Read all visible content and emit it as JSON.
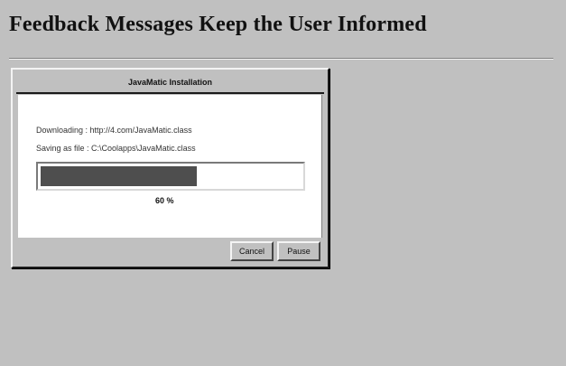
{
  "page": {
    "title": "Feedback Messages Keep the User Informed"
  },
  "dialog": {
    "title": "JavaMatic Installation",
    "downloading_text": "Downloading : http://4.com/JavaMatic.class",
    "saving_text": "Saving as file : C:\\Coolapps\\JavaMatic.class",
    "progress": {
      "fraction": 0.6,
      "label": "60 %"
    },
    "buttons": {
      "cancel_label": "Cancel",
      "pause_label": "Pause"
    }
  },
  "colors": {
    "background": "#c0c0c0",
    "progress_fill": "#4e4e4e",
    "content_background": "#ffffff"
  }
}
